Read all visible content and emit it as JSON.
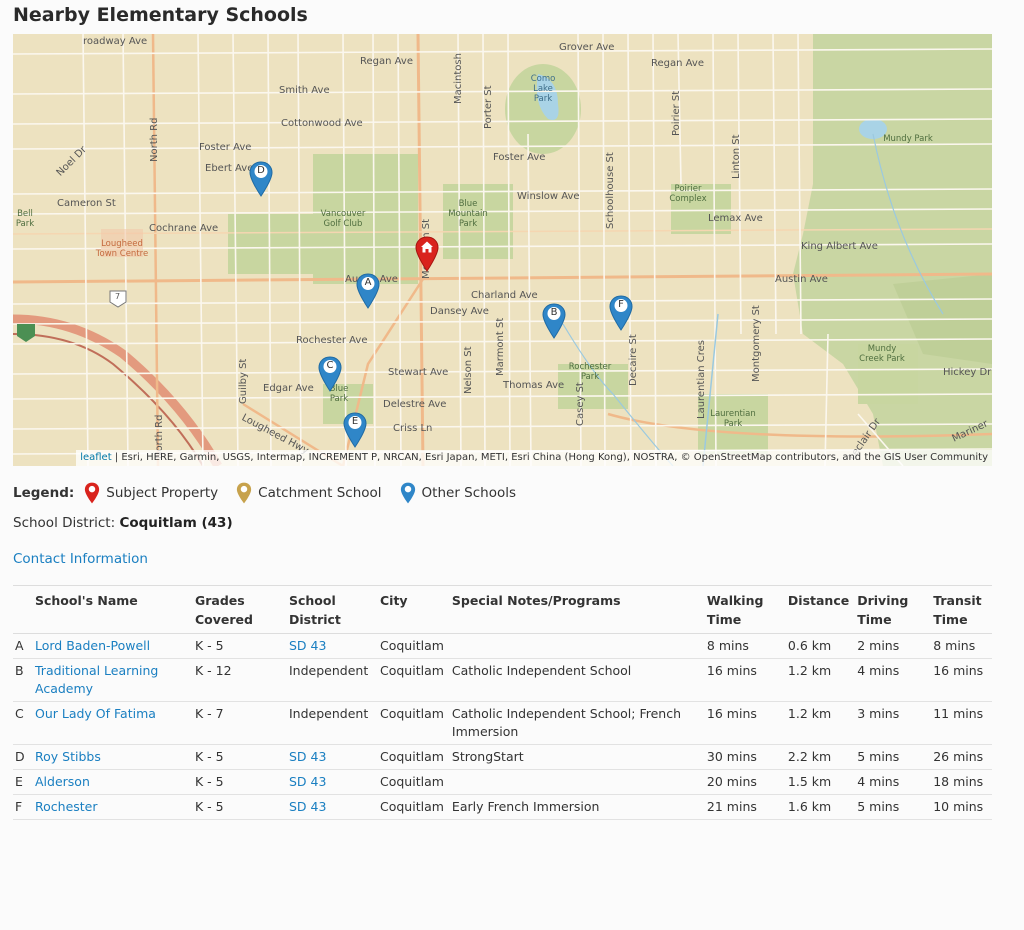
{
  "title": "Nearby Elementary Schools",
  "map": {
    "attribution_leaflet": "leaflet",
    "attribution_rest": " | Esri, HERE, Garmin, USGS, Intermap, INCREMENT P, NRCAN, Esri Japan, METI, Esri China (Hong Kong), NOSTRA, © OpenStreetMap contributors, and the GIS User Community",
    "labels": {
      "broadway": "roadway Ave",
      "regan_w": "Regan Ave",
      "smith": "Smith Ave",
      "cottonwood": "Cottonwood Ave",
      "foster_w": "Foster Ave",
      "ebert": "Ebert Ave",
      "noel": "Noel Dr",
      "north_rd": "North Rd",
      "north_rd2": "North Rd",
      "cameron": "Cameron St",
      "cochrane": "Cochrane Ave",
      "bell_park": "Bell Park",
      "lougheed_tc": "Lougheed Town Centre",
      "vgc": "Vancouver Golf Club",
      "blue_mtn": "Blue Mountain Park",
      "grover": "Grover Ave",
      "regan_e": "Regan Ave",
      "como": "Como Lake Park",
      "porter": "Porter St",
      "macintosh": "Macintosh",
      "mountain": "Mountain St",
      "foster_e": "Foster Ave",
      "winslow": "Winslow Ave",
      "schoolhouse": "Schoolhouse St",
      "poirier_st": "Poirier St",
      "poirier_complex": "Poirier Complex",
      "linton": "Linton St",
      "mundy": "Mundy Park",
      "lemax": "Lemax Ave",
      "king_albert": "King Albert Ave",
      "austin_e": "Austin Ave",
      "austin_w": "Austin Ave",
      "charland": "Charland Ave",
      "dansey": "Dansey Ave",
      "rochester_ave": "Rochester Ave",
      "stewart": "Stewart Ave",
      "edgar": "Edgar Ave",
      "delestre": "Delestre Ave",
      "criss": "Criss Ln",
      "thomas": "Thomas Ave",
      "rochester_park": "Rochester Park",
      "blue_park": "Blue Park",
      "laurentian_park": "Laurentian Park",
      "mundy_creek": "Mundy Creek Park",
      "hickey": "Hickey Dr",
      "guilby": "Guilby St",
      "nelson": "Nelson St",
      "marmont": "Marmont St",
      "casey": "Casey St",
      "decaire": "Decaire St",
      "laurentian_cres": "Laurentian Cres",
      "montgomery": "Montgomery St",
      "lougheed_hwy": "Lougheed Hwy",
      "mariner": "Mariner",
      "leclair": "Leclair Dr",
      "hwy7": "7"
    },
    "markers": [
      "A",
      "B",
      "C",
      "D",
      "E",
      "F"
    ]
  },
  "legend": {
    "title": "Legend:",
    "subject": "Subject Property",
    "catchment": "Catchment School",
    "other": "Other Schools",
    "colors": {
      "subject": "#d9231d",
      "catchment": "#c7a24c",
      "other": "#2f86c8"
    }
  },
  "district": {
    "label": "School District: ",
    "value": "Coquitlam (43)"
  },
  "contact_link": "Contact Information",
  "table": {
    "headers": {
      "name": "School's Name",
      "grades_1": "Grades",
      "grades_2": "Covered",
      "district_1": "School",
      "district_2": "District",
      "city": "City",
      "notes": "Special Notes/Programs",
      "walking_1": "Walking",
      "walking_2": "Time",
      "distance": "Distance",
      "driving_1": "Driving",
      "driving_2": "Time",
      "transit_1": "Transit",
      "transit_2": "Time"
    },
    "rows": [
      {
        "letter": "A",
        "name": "Lord Baden-Powell",
        "grades": "K - 5",
        "district": "SD 43",
        "city": "Coquitlam",
        "notes": "",
        "walking": "8 mins",
        "distance": "0.6 km",
        "driving": "2 mins",
        "transit": "8 mins"
      },
      {
        "letter": "B",
        "name": "Traditional Learning Academy",
        "grades": "K - 12",
        "district": "Independent",
        "city": "Coquitlam",
        "notes": "Catholic Independent School",
        "walking": "16 mins",
        "distance": "1.2 km",
        "driving": "4 mins",
        "transit": "16 mins"
      },
      {
        "letter": "C",
        "name": "Our Lady Of Fatima",
        "grades": "K - 7",
        "district": "Independent",
        "city": "Coquitlam",
        "notes": "Catholic Independent School; French Immersion",
        "walking": "16 mins",
        "distance": "1.2 km",
        "driving": "3 mins",
        "transit": "11 mins"
      },
      {
        "letter": "D",
        "name": "Roy Stibbs",
        "grades": "K - 5",
        "district": "SD 43",
        "city": "Coquitlam",
        "notes": "StrongStart",
        "walking": "30 mins",
        "distance": "2.2 km",
        "driving": "5 mins",
        "transit": "26 mins"
      },
      {
        "letter": "E",
        "name": "Alderson",
        "grades": "K - 5",
        "district": "SD 43",
        "city": "Coquitlam",
        "notes": "",
        "walking": "20 mins",
        "distance": "1.5 km",
        "driving": "4 mins",
        "transit": "18 mins"
      },
      {
        "letter": "F",
        "name": "Rochester",
        "grades": "K - 5",
        "district": "SD 43",
        "city": "Coquitlam",
        "notes": "Early French Immersion",
        "walking": "21 mins",
        "distance": "1.6 km",
        "driving": "5 mins",
        "transit": "10 mins"
      }
    ]
  }
}
